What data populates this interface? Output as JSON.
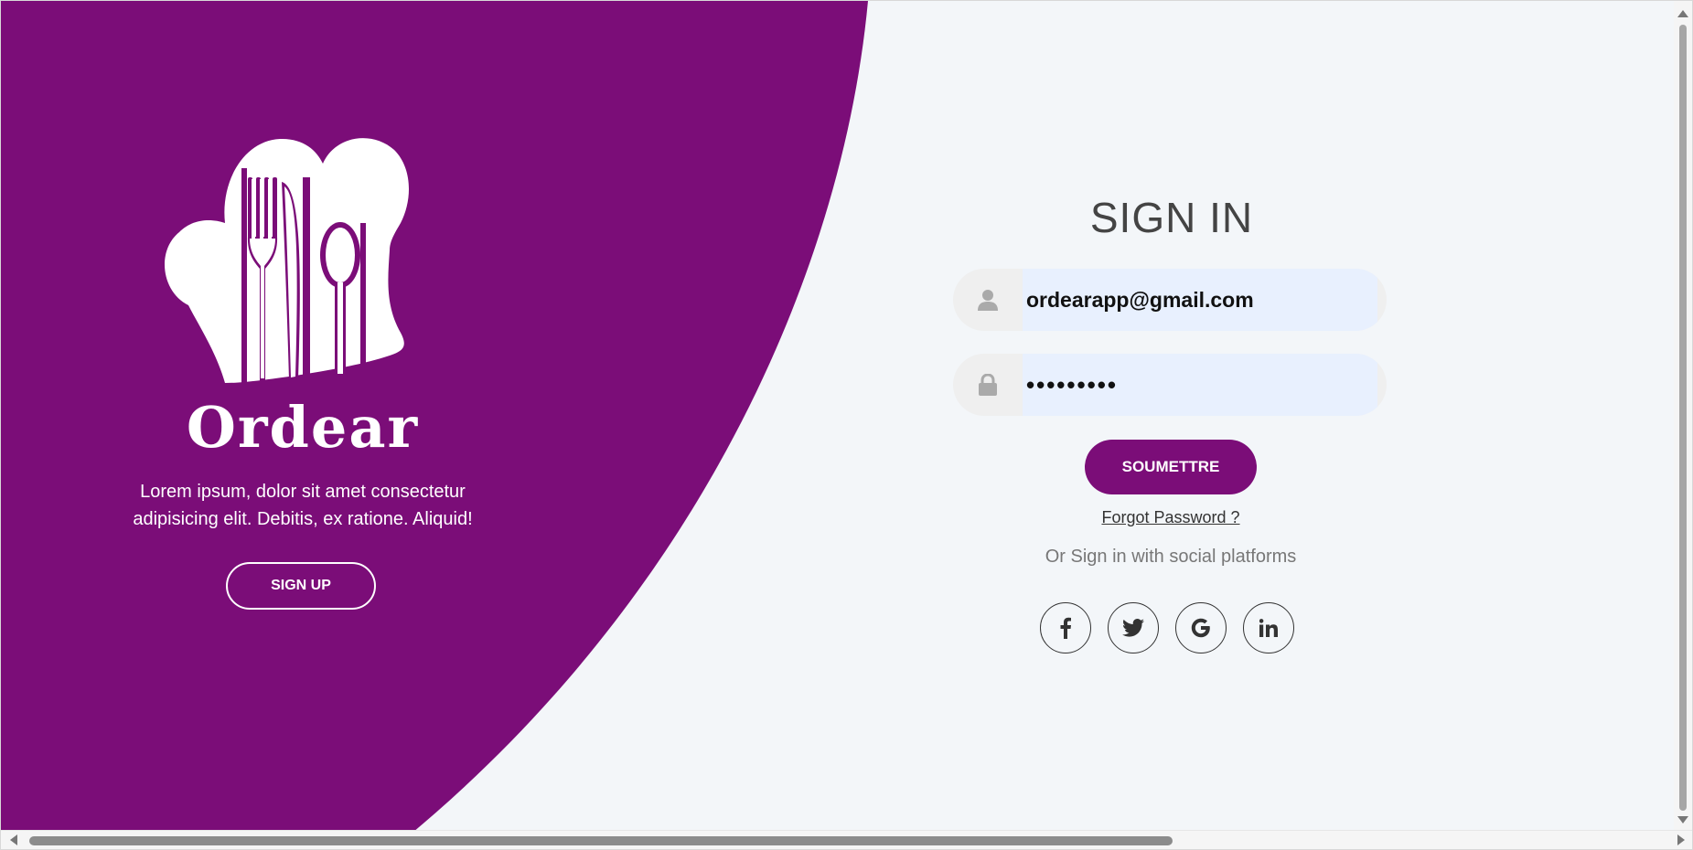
{
  "colors": {
    "brand_purple": "#7b0d78",
    "page_bg": "#f3f6f9",
    "input_bg": "#e8f0fe"
  },
  "left": {
    "brand_name": "Ordear",
    "description": "Lorem ipsum, dolor sit amet consectetur adipisicing elit. Debitis, ex ratione. Aliquid!",
    "signup_label": "SIGN UP",
    "logo_icon": "chef-hat-cutlery-logo"
  },
  "signin": {
    "title": "SIGN IN",
    "email_value": "ordearapp@gmail.com",
    "email_icon": "user-icon",
    "password_value": "•••••••••",
    "password_icon": "lock-icon",
    "submit_label": "SOUMETTRE",
    "forgot_label": "Forgot Password ?",
    "social_text": "Or Sign in with social platforms",
    "social": [
      {
        "name": "facebook-icon",
        "glyph": "f"
      },
      {
        "name": "twitter-icon",
        "glyph": "t"
      },
      {
        "name": "google-icon",
        "glyph": "G"
      },
      {
        "name": "linkedin-icon",
        "glyph": "in"
      }
    ]
  }
}
